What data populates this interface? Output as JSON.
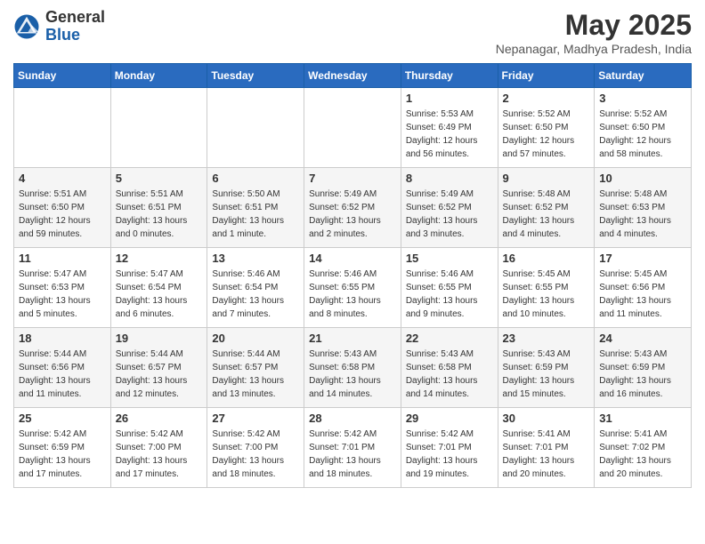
{
  "header": {
    "logo_general": "General",
    "logo_blue": "Blue",
    "month_title": "May 2025",
    "location": "Nepanagar, Madhya Pradesh, India"
  },
  "days_of_week": [
    "Sunday",
    "Monday",
    "Tuesday",
    "Wednesday",
    "Thursday",
    "Friday",
    "Saturday"
  ],
  "weeks": [
    [
      {
        "day": "",
        "info": ""
      },
      {
        "day": "",
        "info": ""
      },
      {
        "day": "",
        "info": ""
      },
      {
        "day": "",
        "info": ""
      },
      {
        "day": "1",
        "info": "Sunrise: 5:53 AM\nSunset: 6:49 PM\nDaylight: 12 hours\nand 56 minutes."
      },
      {
        "day": "2",
        "info": "Sunrise: 5:52 AM\nSunset: 6:50 PM\nDaylight: 12 hours\nand 57 minutes."
      },
      {
        "day": "3",
        "info": "Sunrise: 5:52 AM\nSunset: 6:50 PM\nDaylight: 12 hours\nand 58 minutes."
      }
    ],
    [
      {
        "day": "4",
        "info": "Sunrise: 5:51 AM\nSunset: 6:50 PM\nDaylight: 12 hours\nand 59 minutes."
      },
      {
        "day": "5",
        "info": "Sunrise: 5:51 AM\nSunset: 6:51 PM\nDaylight: 13 hours\nand 0 minutes."
      },
      {
        "day": "6",
        "info": "Sunrise: 5:50 AM\nSunset: 6:51 PM\nDaylight: 13 hours\nand 1 minute."
      },
      {
        "day": "7",
        "info": "Sunrise: 5:49 AM\nSunset: 6:52 PM\nDaylight: 13 hours\nand 2 minutes."
      },
      {
        "day": "8",
        "info": "Sunrise: 5:49 AM\nSunset: 6:52 PM\nDaylight: 13 hours\nand 3 minutes."
      },
      {
        "day": "9",
        "info": "Sunrise: 5:48 AM\nSunset: 6:52 PM\nDaylight: 13 hours\nand 4 minutes."
      },
      {
        "day": "10",
        "info": "Sunrise: 5:48 AM\nSunset: 6:53 PM\nDaylight: 13 hours\nand 4 minutes."
      }
    ],
    [
      {
        "day": "11",
        "info": "Sunrise: 5:47 AM\nSunset: 6:53 PM\nDaylight: 13 hours\nand 5 minutes."
      },
      {
        "day": "12",
        "info": "Sunrise: 5:47 AM\nSunset: 6:54 PM\nDaylight: 13 hours\nand 6 minutes."
      },
      {
        "day": "13",
        "info": "Sunrise: 5:46 AM\nSunset: 6:54 PM\nDaylight: 13 hours\nand 7 minutes."
      },
      {
        "day": "14",
        "info": "Sunrise: 5:46 AM\nSunset: 6:55 PM\nDaylight: 13 hours\nand 8 minutes."
      },
      {
        "day": "15",
        "info": "Sunrise: 5:46 AM\nSunset: 6:55 PM\nDaylight: 13 hours\nand 9 minutes."
      },
      {
        "day": "16",
        "info": "Sunrise: 5:45 AM\nSunset: 6:55 PM\nDaylight: 13 hours\nand 10 minutes."
      },
      {
        "day": "17",
        "info": "Sunrise: 5:45 AM\nSunset: 6:56 PM\nDaylight: 13 hours\nand 11 minutes."
      }
    ],
    [
      {
        "day": "18",
        "info": "Sunrise: 5:44 AM\nSunset: 6:56 PM\nDaylight: 13 hours\nand 11 minutes."
      },
      {
        "day": "19",
        "info": "Sunrise: 5:44 AM\nSunset: 6:57 PM\nDaylight: 13 hours\nand 12 minutes."
      },
      {
        "day": "20",
        "info": "Sunrise: 5:44 AM\nSunset: 6:57 PM\nDaylight: 13 hours\nand 13 minutes."
      },
      {
        "day": "21",
        "info": "Sunrise: 5:43 AM\nSunset: 6:58 PM\nDaylight: 13 hours\nand 14 minutes."
      },
      {
        "day": "22",
        "info": "Sunrise: 5:43 AM\nSunset: 6:58 PM\nDaylight: 13 hours\nand 14 minutes."
      },
      {
        "day": "23",
        "info": "Sunrise: 5:43 AM\nSunset: 6:59 PM\nDaylight: 13 hours\nand 15 minutes."
      },
      {
        "day": "24",
        "info": "Sunrise: 5:43 AM\nSunset: 6:59 PM\nDaylight: 13 hours\nand 16 minutes."
      }
    ],
    [
      {
        "day": "25",
        "info": "Sunrise: 5:42 AM\nSunset: 6:59 PM\nDaylight: 13 hours\nand 17 minutes."
      },
      {
        "day": "26",
        "info": "Sunrise: 5:42 AM\nSunset: 7:00 PM\nDaylight: 13 hours\nand 17 minutes."
      },
      {
        "day": "27",
        "info": "Sunrise: 5:42 AM\nSunset: 7:00 PM\nDaylight: 13 hours\nand 18 minutes."
      },
      {
        "day": "28",
        "info": "Sunrise: 5:42 AM\nSunset: 7:01 PM\nDaylight: 13 hours\nand 18 minutes."
      },
      {
        "day": "29",
        "info": "Sunrise: 5:42 AM\nSunset: 7:01 PM\nDaylight: 13 hours\nand 19 minutes."
      },
      {
        "day": "30",
        "info": "Sunrise: 5:41 AM\nSunset: 7:01 PM\nDaylight: 13 hours\nand 20 minutes."
      },
      {
        "day": "31",
        "info": "Sunrise: 5:41 AM\nSunset: 7:02 PM\nDaylight: 13 hours\nand 20 minutes."
      }
    ]
  ]
}
